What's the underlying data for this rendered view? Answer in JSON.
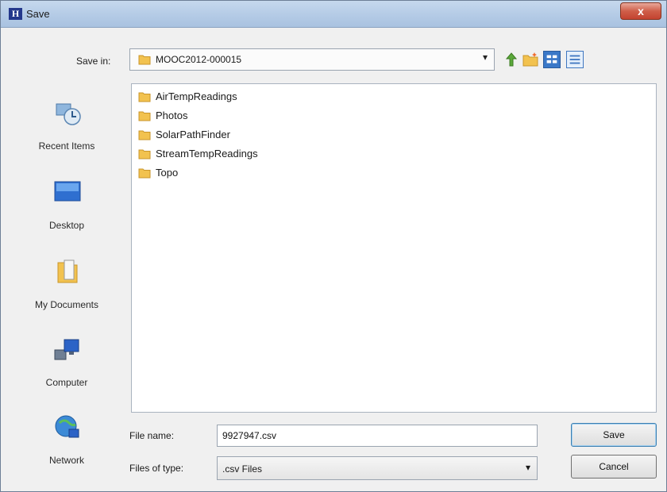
{
  "window": {
    "title": "Save",
    "app_icon_letter": "H",
    "close_symbol": "x"
  },
  "save_in": {
    "label": "Save in:",
    "value": "MOOC2012-000015"
  },
  "places": [
    {
      "label": "Recent Items",
      "icon": "recent-items-icon"
    },
    {
      "label": "Desktop",
      "icon": "desktop-icon"
    },
    {
      "label": "My Documents",
      "icon": "my-documents-icon"
    },
    {
      "label": "Computer",
      "icon": "computer-icon"
    },
    {
      "label": "Network",
      "icon": "network-icon"
    }
  ],
  "files": [
    {
      "name": "AirTempReadings"
    },
    {
      "name": "Photos"
    },
    {
      "name": "SolarPathFinder"
    },
    {
      "name": "StreamTempReadings"
    },
    {
      "name": "Topo"
    }
  ],
  "file_name": {
    "label": "File name:",
    "value": "9927947.csv"
  },
  "file_type": {
    "label": "Files of type:",
    "value": ".csv Files"
  },
  "buttons": {
    "save": "Save",
    "cancel": "Cancel"
  },
  "colors": {
    "folder": "#f2c24f",
    "titlebar": "#b4cbe6",
    "accent": "#3a78c8"
  }
}
